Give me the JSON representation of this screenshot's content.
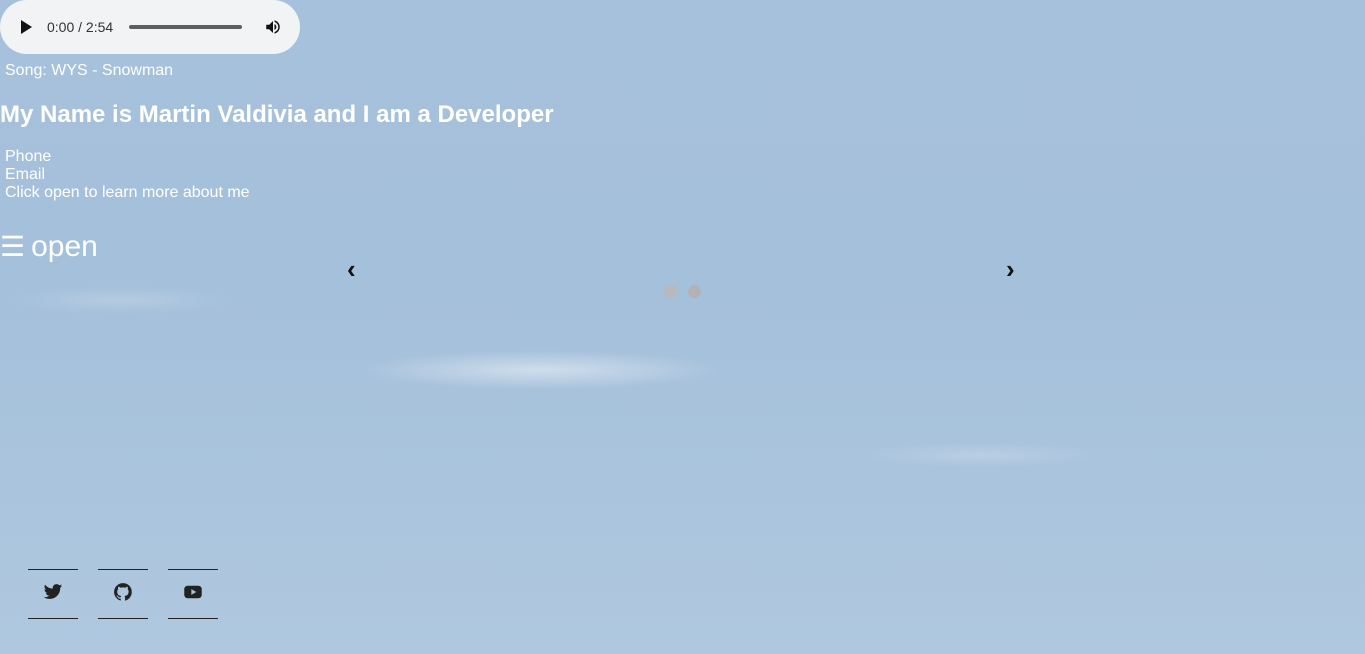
{
  "audio": {
    "time": "0:00 / 2:54",
    "progress": 0,
    "icons": [
      "play-icon",
      "volume-icon"
    ]
  },
  "song": "Song: WYS - Snowman",
  "headline": "My Name is Martin Valdivia and I am a Developer",
  "info": {
    "phone": "Phone",
    "email": "Email",
    "about": "Click open to learn more about me"
  },
  "menu": {
    "icon": "☰",
    "label": "open"
  },
  "carousel": {
    "prev": "‹",
    "next": "›",
    "dots": 2
  },
  "social": [
    "twitter-icon",
    "github-icon",
    "youtube-icon"
  ],
  "colors": {
    "text": "#ffffff",
    "sky": "#a6c1dc",
    "player_bg": "#f1f3f4",
    "arrows": "#111111"
  }
}
